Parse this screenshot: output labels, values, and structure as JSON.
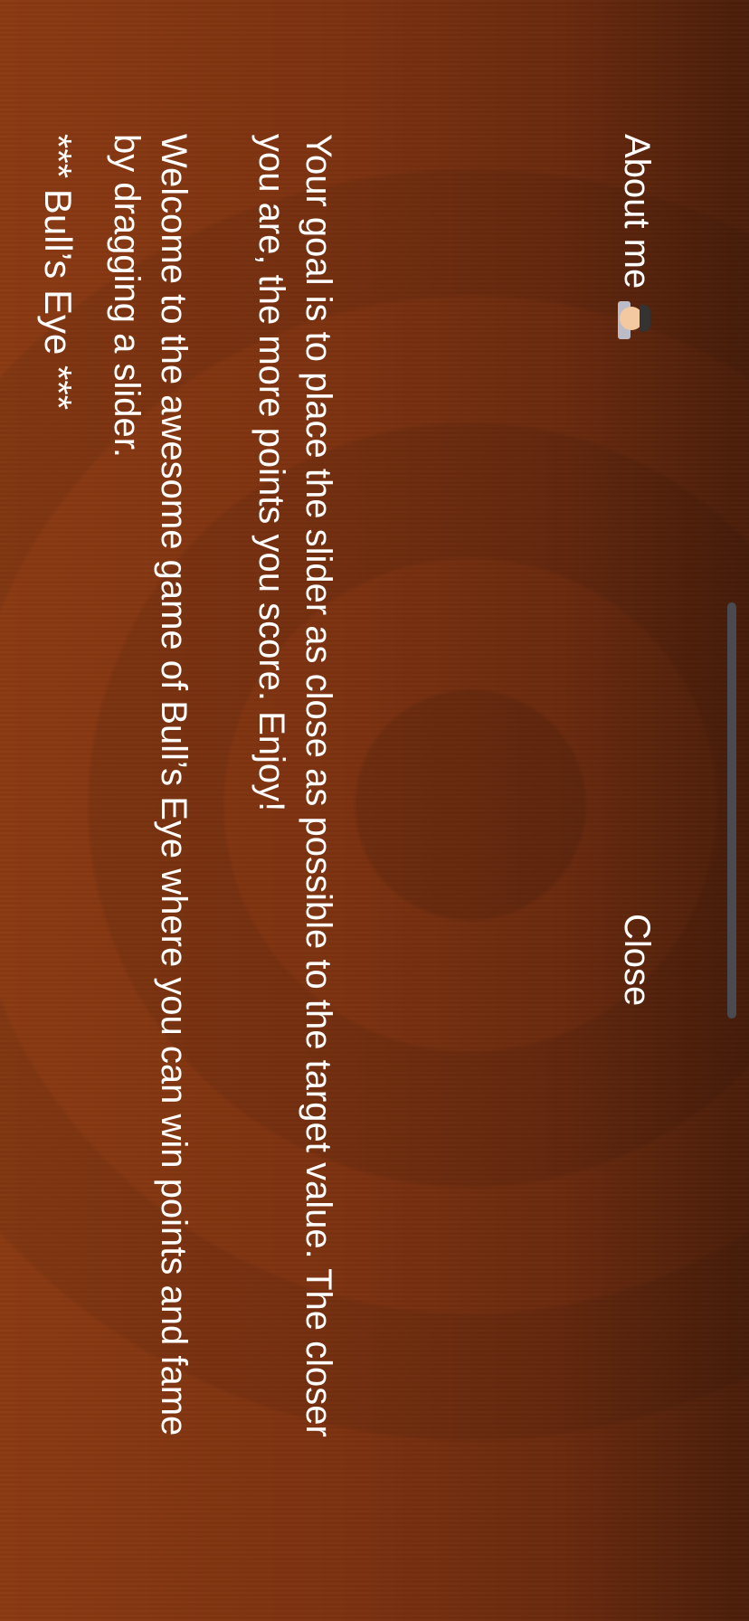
{
  "screen": {
    "title": "*** Bull’s Eye ***",
    "welcome_text": "Welcome to the awesome game of Bull’s Eye where you can win points and fame by dragging a slider.",
    "goal_text": "Your goal is to place the slider as close as possible to the target value.  The closer you are, the more points you score. Enjoy!",
    "about_label": "About me",
    "about_icon": "technologist-emoji-icon",
    "close_label": "Close"
  },
  "colors": {
    "background": "#7a3010",
    "text": "#ffffff",
    "home_indicator": "#4a4a50"
  }
}
